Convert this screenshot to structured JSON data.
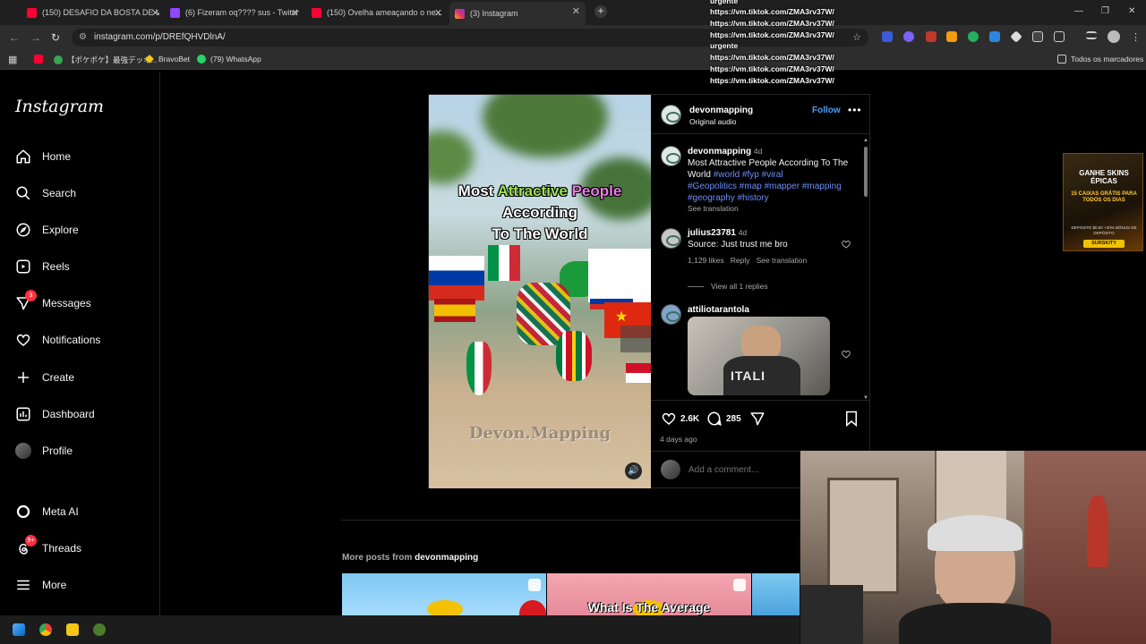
{
  "browser": {
    "tabs": [
      {
        "title": "(150) DESAFIO DA BOSTA DE V...",
        "icon": "youtube-icon",
        "color": "#ff0033"
      },
      {
        "title": "(6) Fizeram oq???? sus - Twitch",
        "icon": "twitch-icon",
        "color": "#9146ff"
      },
      {
        "title": "(150) Ovelha ameaçando o ne...",
        "icon": "youtube-icon",
        "color": "#ff0033"
      },
      {
        "title": "(3) Instagram",
        "icon": "instagram-icon",
        "color": "#e1306c"
      }
    ],
    "url": "instagram.com/p/DREfQHVDlnA/",
    "bookmarks": [
      {
        "label": "",
        "icon": "youtube-icon"
      },
      {
        "label": "【ポケポケ】最強デッキ...",
        "icon": "bookmark-icon"
      },
      {
        "label": "BravoBet",
        "icon": "bravobet-icon"
      },
      {
        "label": "(79) WhatsApp",
        "icon": "whatsapp-icon"
      }
    ],
    "all_bookmarks_label": "Todos os marcadores"
  },
  "overlay_lines": [
    "urgente",
    "https://vm.tiktok.com/ZMA3rv37W/",
    "https://vm.tiktok.com/ZMA3rv37W/",
    "https://vm.tiktok.com/ZMA3rv37W/",
    "urgente",
    "https://vm.tiktok.com/ZMA3rv37W/",
    "https://vm.tiktok.com/ZMA3rv37W/",
    "https://vm.tiktok.com/ZMA3rv37W/"
  ],
  "sidebar": {
    "logo": "Instagram",
    "items": [
      {
        "label": "Home",
        "icon": "home-icon"
      },
      {
        "label": "Search",
        "icon": "search-icon"
      },
      {
        "label": "Explore",
        "icon": "explore-icon"
      },
      {
        "label": "Reels",
        "icon": "reels-icon"
      },
      {
        "label": "Messages",
        "icon": "messages-icon",
        "badge": "3"
      },
      {
        "label": "Notifications",
        "icon": "heart-icon"
      },
      {
        "label": "Create",
        "icon": "plus-icon"
      },
      {
        "label": "Dashboard",
        "icon": "dashboard-icon"
      },
      {
        "label": "Profile",
        "icon": "avatar-icon"
      },
      {
        "label": "Meta AI",
        "icon": "meta-ai-icon"
      },
      {
        "label": "Threads",
        "icon": "threads-icon",
        "badge": "9+"
      },
      {
        "label": "More",
        "icon": "menu-icon"
      }
    ]
  },
  "post": {
    "media": {
      "title_line1_a": "Most ",
      "title_line1_b": "Attractive",
      "title_line1_c": " People",
      "title_line2": "According",
      "title_line3": "To The World",
      "watermark": "Devon.Mapping"
    },
    "author": "devonmapping",
    "audio": "Original audio",
    "follow": "Follow",
    "caption": {
      "author": "devonmapping",
      "age": "4d",
      "text": "Most Attractive People According To The World",
      "hashtags_1": "#world #fyp #viral",
      "hashtags_2": "#Geopolitics #map #mapper #mapping",
      "hashtags_3": "#geography #history",
      "see_translation": "See translation"
    },
    "comments": [
      {
        "user": "julius23781",
        "age": "4d",
        "text": "Source: Just trust me bro",
        "likes": "1,129 likes",
        "reply": "Reply",
        "translate": "See translation",
        "view_replies": "View all 1 replies"
      },
      {
        "user": "attiliotarantola",
        "gif_text": "ITALI"
      }
    ],
    "likes_count": "2.6K",
    "comments_count": "285",
    "posted": "4 days ago",
    "add_comment_placeholder": "Add a comment..."
  },
  "more_posts": {
    "prefix": "More posts from ",
    "user": "devonmapping",
    "thumb_titles": [
      "",
      "What Is The Average",
      ""
    ]
  },
  "ad": {
    "line1": "GANHE SKINS",
    "line2": "ÉPICAS",
    "line3": "15 CAIXAS GRÁTIS PARA TODOS OS DIAS",
    "line4": "DEPOSITE $0.50 +20% BÔNUS DE DEPÓSITO",
    "code": "SURSKITY"
  },
  "colors": {
    "accent": "#4a9df8",
    "hashtag": "#6c8df7",
    "badge": "#ff3040"
  }
}
